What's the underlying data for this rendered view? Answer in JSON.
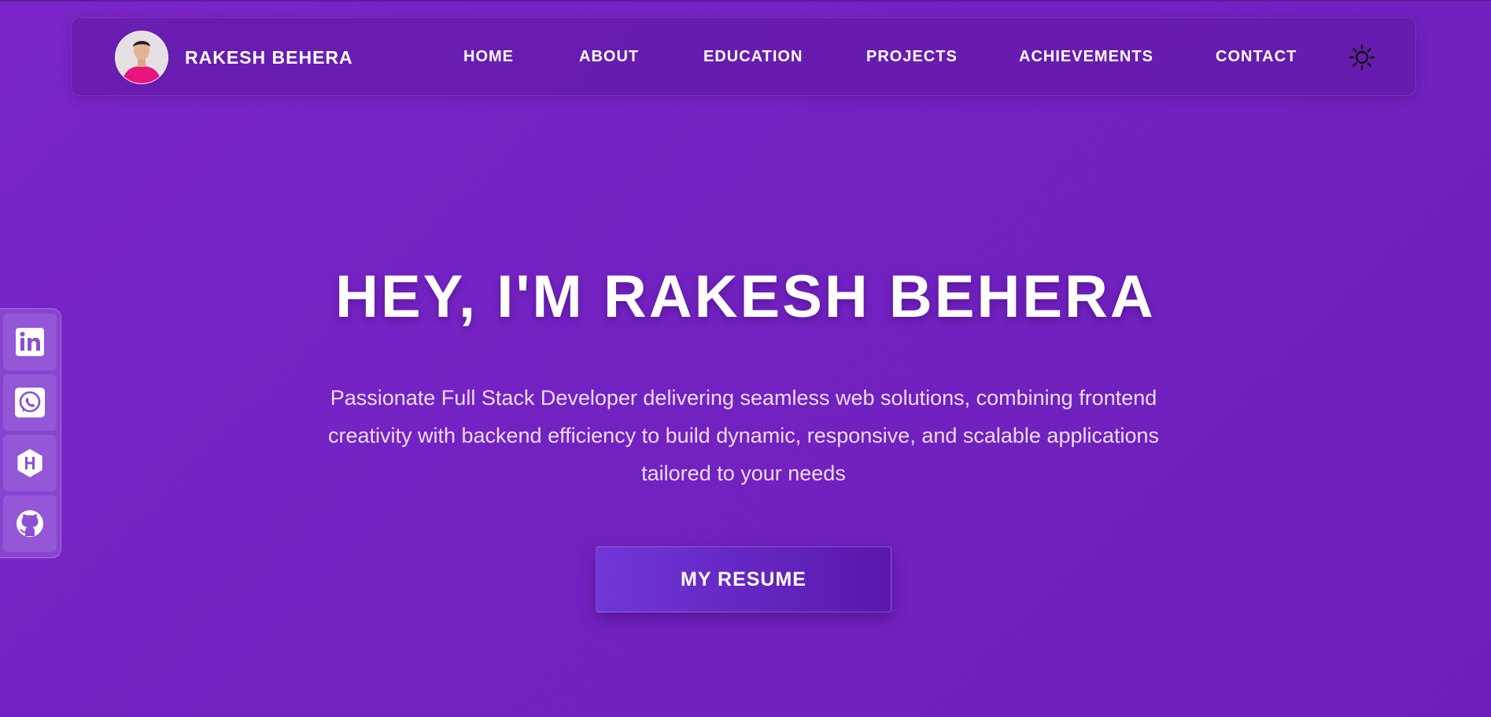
{
  "brand": {
    "name": "RAKESH BEHERA",
    "avatar_icon": "profile-photo"
  },
  "nav": {
    "items": [
      {
        "label": "HOME"
      },
      {
        "label": "ABOUT"
      },
      {
        "label": "EDUCATION"
      },
      {
        "label": "PROJECTS"
      },
      {
        "label": "ACHIEVEMENTS"
      },
      {
        "label": "CONTACT"
      }
    ],
    "theme_toggle_icon": "sun-icon"
  },
  "hero": {
    "title": "HEY, I'M RAKESH BEHERA",
    "subtitle": "Passionate Full Stack Developer delivering seamless web solutions, combining frontend creativity with backend efficiency to build dynamic, responsive, and scalable applications tailored to your needs",
    "button_label": "MY RESUME"
  },
  "social": {
    "items": [
      {
        "icon": "linkedin-icon"
      },
      {
        "icon": "whatsapp-icon"
      },
      {
        "icon": "hashnode-icon"
      },
      {
        "icon": "github-icon"
      }
    ]
  },
  "colors": {
    "background": "#7322c2",
    "navbar": "#621aa8",
    "button_start": "#7037d8",
    "button_end": "#5a17ad",
    "text": "#ffffff",
    "subtitle_text": "#eadcf7"
  }
}
